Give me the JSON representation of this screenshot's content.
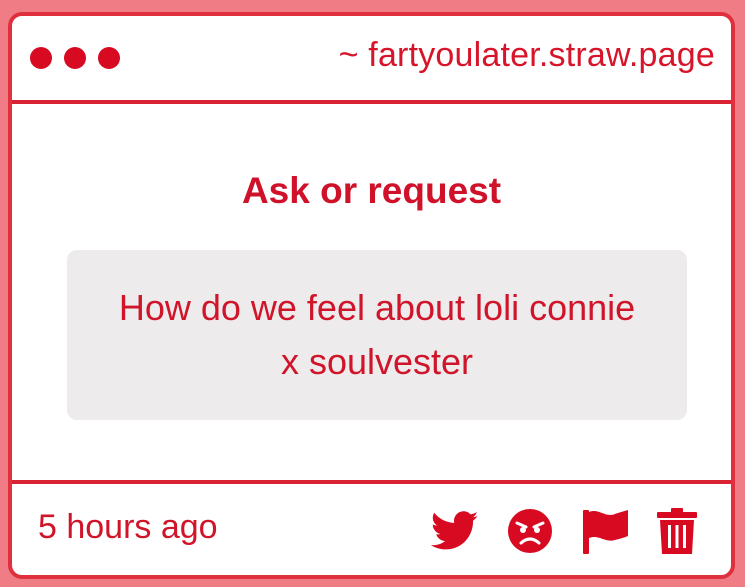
{
  "titlebar": {
    "url": "~ fartyoulater.straw.page"
  },
  "main": {
    "heading": "Ask or request",
    "message": "How do we feel about loli connie x soulvester"
  },
  "footer": {
    "timestamp": "5 hours ago",
    "actions": [
      {
        "icon": "twitter-icon"
      },
      {
        "icon": "angry-face-icon"
      },
      {
        "icon": "flag-icon"
      },
      {
        "icon": "trash-icon"
      }
    ]
  },
  "colors": {
    "background": "#f07c86",
    "accent": "#d70a22",
    "border": "#e0303e",
    "message_bg": "#edebec"
  }
}
